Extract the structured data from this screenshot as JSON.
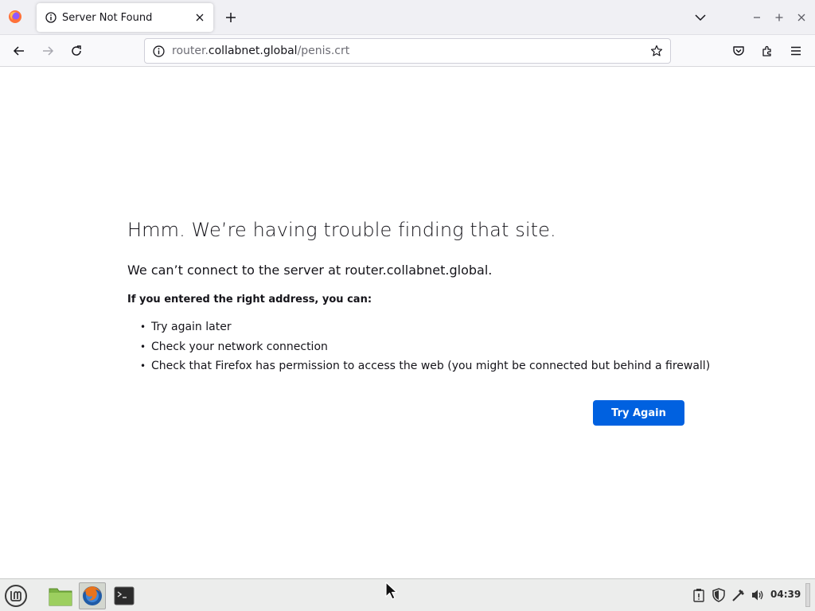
{
  "browser": {
    "tab": {
      "title": "Server Not Found"
    },
    "url": {
      "prefix": "router.",
      "host": "collabnet.global",
      "path": "/penis.crt"
    }
  },
  "error": {
    "title": "Hmm. We’re having trouble finding that site.",
    "description": "We can’t connect to the server at router.collabnet.global.",
    "subtitle": "If you entered the right address, you can:",
    "items": [
      "Try again later",
      "Check your network connection",
      "Check that Firefox has permission to access the web (you might be connected but behind a firewall)"
    ],
    "button_label": "Try Again"
  },
  "taskbar": {
    "clock": "04:39",
    "apps": [
      "mint-menu-icon",
      "files-icon",
      "firefox-icon",
      "terminal-icon"
    ]
  },
  "colors": {
    "accent": "#0061e0",
    "tabstrip": "#f0f0f4",
    "taskbar": "#ecedec"
  }
}
